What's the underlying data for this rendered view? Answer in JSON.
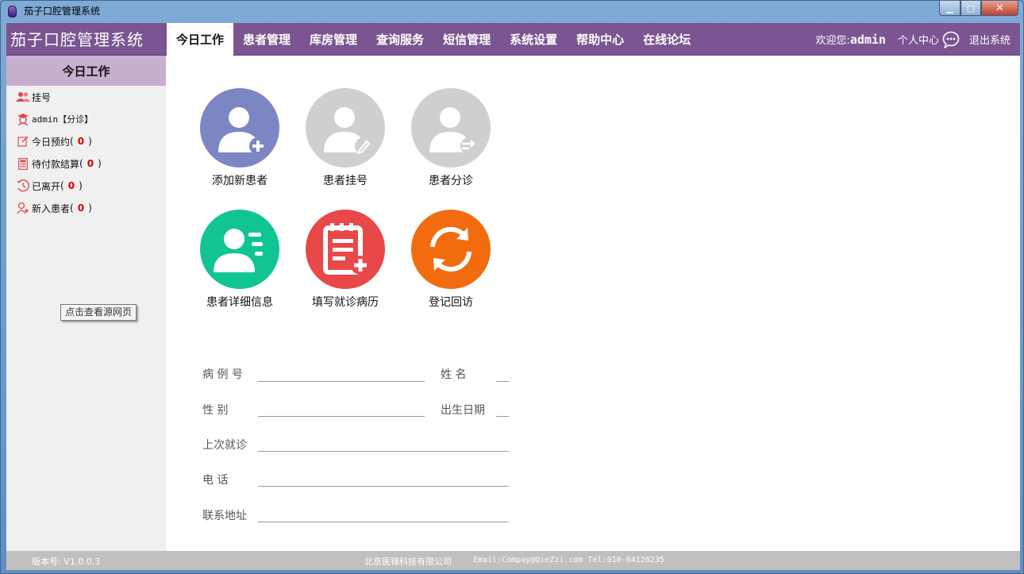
{
  "window": {
    "title": "茄子口腔管理系统",
    "minimize_glyph": "▁",
    "maximize_glyph": "□",
    "close_glyph": "✕"
  },
  "header": {
    "brand": "茄子口腔管理系统",
    "tabs": [
      {
        "label": "今日工作",
        "active": true
      },
      {
        "label": "患者管理"
      },
      {
        "label": "库房管理"
      },
      {
        "label": "查询服务"
      },
      {
        "label": "短信管理"
      },
      {
        "label": "系统设置"
      },
      {
        "label": "帮助中心"
      },
      {
        "label": "在线论坛"
      }
    ],
    "welcome": "欢迎您:",
    "username": "admin",
    "profile": "个人中心",
    "logout": "退出系统"
  },
  "sidebar": {
    "title": "今日工作",
    "items": [
      {
        "label": "挂号",
        "icon": "users-icon"
      },
      {
        "label": "admin【分诊】",
        "icon": "doctor-icon"
      },
      {
        "label": "今日预约",
        "count": "0",
        "icon": "edit-icon"
      },
      {
        "label": "待付款结算",
        "count": "0",
        "icon": "calculator-icon"
      },
      {
        "label": "已离开",
        "count": "0",
        "icon": "clock-icon"
      },
      {
        "label": "新入患者",
        "count": "0",
        "icon": "user-add-icon"
      }
    ],
    "paren_open": "(",
    "paren_close": ")",
    "tooltip": "点击查看源网页"
  },
  "tiles": [
    {
      "label": "添加新患者",
      "color": "#7b86c2",
      "icon": "user-add-icon"
    },
    {
      "label": "患者挂号",
      "color": "#cfcfcf",
      "icon": "user-edit-icon"
    },
    {
      "label": "患者分诊",
      "color": "#cfcfcf",
      "icon": "user-transfer-icon"
    },
    {
      "label": "患者详细信息",
      "color": "#11c593",
      "icon": "user-detail-icon"
    },
    {
      "label": "填写就诊病历",
      "color": "#e84848",
      "icon": "record-add-icon"
    },
    {
      "label": "登记回访",
      "color": "#f26c0f",
      "icon": "refresh-icon"
    }
  ],
  "form": {
    "case_no": "病 例 号",
    "name": "姓 名",
    "gender": "性 别",
    "birth": "出生日期",
    "last_visit": "上次就诊",
    "phone": "电 话",
    "address": "联系地址"
  },
  "footer": {
    "version": "版本号: V1.0.0.3",
    "company": "北京医锦科技有限公司",
    "contact": "Email:Compay@QieZzi.com Tel:010-64126235"
  },
  "colors": {
    "nav": "#7a5591",
    "sidebar_header": "#c6afcf",
    "count": "#d40000"
  }
}
